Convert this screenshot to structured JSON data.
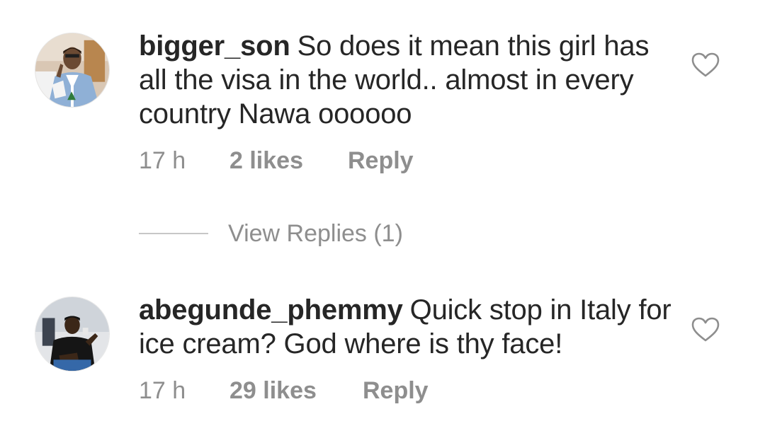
{
  "comments": [
    {
      "username": "bigger_son",
      "text": "So does it mean this girl has all the visa in the world.. almost in every country Nawa oooooo",
      "time": "17 h",
      "likes": "2 likes",
      "reply_label": "Reply",
      "avatar_icon": "avatar-man-blue-suit",
      "like_icon": "heart-outline-icon"
    },
    {
      "username": "abegunde_phemmy",
      "text": "Quick stop in Italy for ice cream? God where is thy face!",
      "time": "17 h",
      "likes": "29 likes",
      "reply_label": "Reply",
      "avatar_icon": "avatar-man-black-shirt",
      "like_icon": "heart-outline-icon"
    }
  ],
  "view_replies": {
    "label": "View Replies (1)"
  },
  "colors": {
    "text": "#262626",
    "secondary": "#8e8e8e",
    "divider": "#c7c7c7"
  }
}
